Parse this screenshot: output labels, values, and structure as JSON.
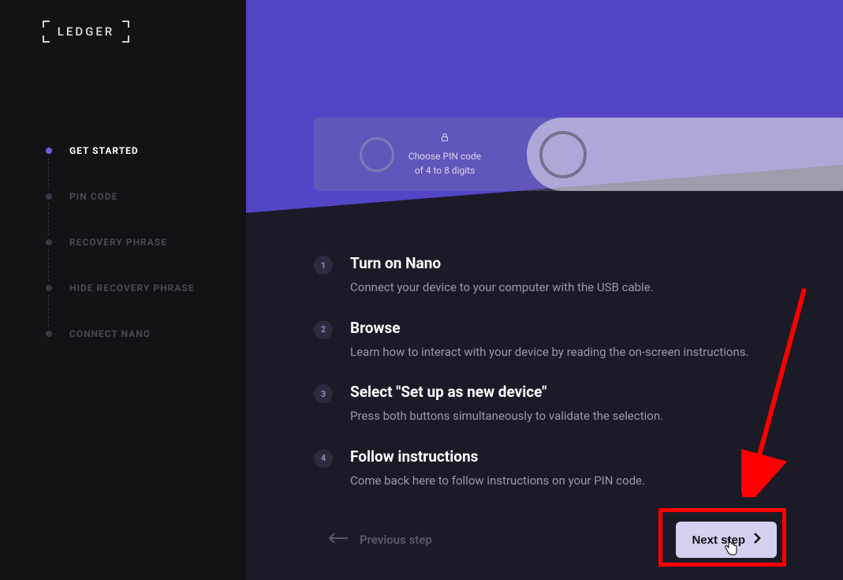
{
  "brand": "LEDGER",
  "sidebar": {
    "items": [
      {
        "label": "GET STARTED",
        "active": true
      },
      {
        "label": "PIN CODE",
        "active": false
      },
      {
        "label": "RECOVERY PHRASE",
        "active": false
      },
      {
        "label": "HIDE RECOVERY PHRASE",
        "active": false
      },
      {
        "label": "CONNECT NANO",
        "active": false
      }
    ]
  },
  "device": {
    "line1": "Choose PIN code",
    "line2": "of 4 to 8 digits"
  },
  "steps": [
    {
      "num": "1",
      "title": "Turn on Nano",
      "desc": "Connect your device to your computer with the USB cable."
    },
    {
      "num": "2",
      "title": "Browse",
      "desc": "Learn how to interact with your device by reading the on-screen instructions."
    },
    {
      "num": "3",
      "title": "Select \"Set up as new device\"",
      "desc": "Press both buttons simultaneously to validate the selection."
    },
    {
      "num": "4",
      "title": "Follow instructions",
      "desc": "Come back here to follow instructions on your PIN code."
    }
  ],
  "footer": {
    "prev": "Previous step",
    "next": "Next step"
  }
}
